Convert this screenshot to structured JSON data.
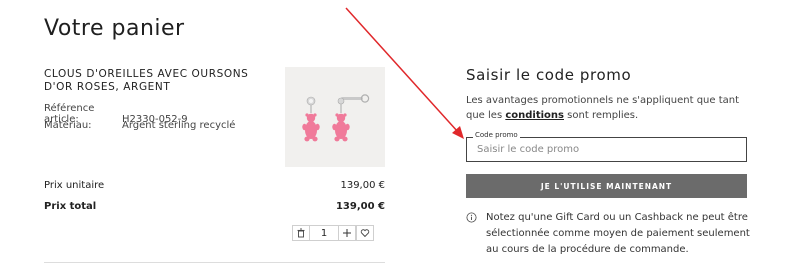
{
  "page": {
    "title": "Votre panier"
  },
  "product": {
    "name": "CLOUS D'OREILLES AVEC OURSONS D'OR ROSES, ARGENT",
    "reference_label": "Référence article:",
    "reference_value": "H2330-052-9",
    "material_label": "Matériau:",
    "material_value": "Argent sterling recyclé",
    "unit_price_label": "Prix unitaire",
    "unit_price_value": "139,00 €",
    "total_price_label": "Prix total",
    "total_price_value": "139,00 €",
    "quantity": "1",
    "colors": {
      "bear": "#f07a9a",
      "silver": "#c9c9c9"
    }
  },
  "promo": {
    "title": "Saisir le code promo",
    "desc_before": "Les avantages promotionnels ne s'appliquent que tant que les ",
    "desc_link": "conditions",
    "desc_after": " sont remplies.",
    "field_label": "Code promo",
    "placeholder": "Saisir le code promo",
    "button_label": "JE L'UTILISE MAINTENANT",
    "notice": "Notez qu'une Gift Card ou un Cashback ne peut être sélectionnée comme moyen de paiement seulement au cours de la procédure de commande."
  },
  "icons": {
    "delete": "trash-icon",
    "increase": "plus-icon",
    "wishlist": "heart-icon",
    "info": "info-icon"
  },
  "colors": {
    "annotation_arrow": "#e0282b",
    "button_bg": "#6b6b6b"
  }
}
